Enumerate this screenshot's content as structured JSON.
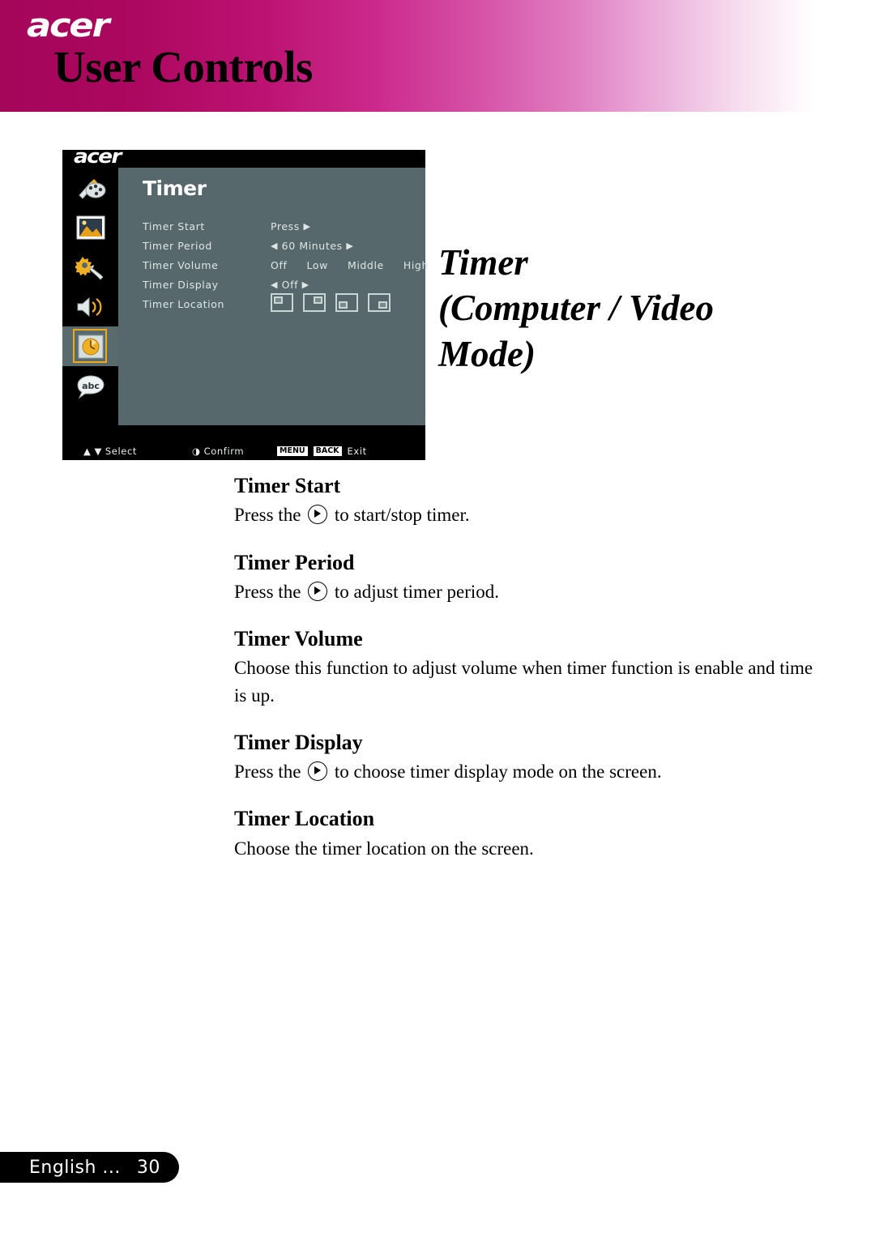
{
  "header": {
    "brand": "acer",
    "title": "User Controls",
    "gradient_start": "#a4065a",
    "gradient_end": "#ffffff"
  },
  "osd": {
    "brand": "acer",
    "menu_title": "Timer",
    "panel_color": "#56688b",
    "highlight_color": "#f0a819",
    "sidebar": [
      {
        "name": "color-palette-icon",
        "label": "Color"
      },
      {
        "name": "image-icon",
        "label": "Image"
      },
      {
        "name": "settings-icon",
        "label": "Setting"
      },
      {
        "name": "audio-icon",
        "label": "Audio"
      },
      {
        "name": "timer-icon",
        "label": "Timer",
        "selected": true
      },
      {
        "name": "language-icon",
        "label": "Language"
      }
    ],
    "rows": [
      {
        "label": "Timer Start",
        "value": "Press",
        "arrow_right": true,
        "arrow_left": false
      },
      {
        "label": "Timer Period",
        "value": "60   Minutes",
        "arrow_right": true,
        "arrow_left": true
      },
      {
        "label": "Timer Volume",
        "options": [
          "Off",
          "Low",
          "Middle",
          "High"
        ]
      },
      {
        "label": "Timer Display",
        "value": "Off",
        "arrow_right": true,
        "arrow_left": true
      },
      {
        "label": "Timer Location",
        "locations": [
          "top-left",
          "top-right",
          "bottom-left",
          "bottom-right"
        ]
      }
    ],
    "bottom_bar": {
      "select": "Select",
      "confirm": "Confirm",
      "menu_key": "MENU",
      "back_key": "BACK",
      "exit": "Exit"
    }
  },
  "side_title": {
    "line1": "Timer",
    "line2": "(Computer / Video",
    "line3": "Mode)"
  },
  "sections": [
    {
      "heading": "Timer Start",
      "body_before": "Press the",
      "body_after": "to start/stop timer."
    },
    {
      "heading": "Timer Period",
      "body_before": "Press the",
      "body_after": "to adjust timer period."
    },
    {
      "heading": "Timer Volume",
      "body_plain": "Choose this function to adjust volume when timer function is enable and time is up."
    },
    {
      "heading": "Timer Display",
      "body_before": "Press the",
      "body_after": "to choose timer display mode on the screen."
    },
    {
      "heading": "Timer Location",
      "body_plain": "Choose the timer location on the screen."
    }
  ],
  "footer": {
    "language": "English ...",
    "page_number": "30"
  }
}
